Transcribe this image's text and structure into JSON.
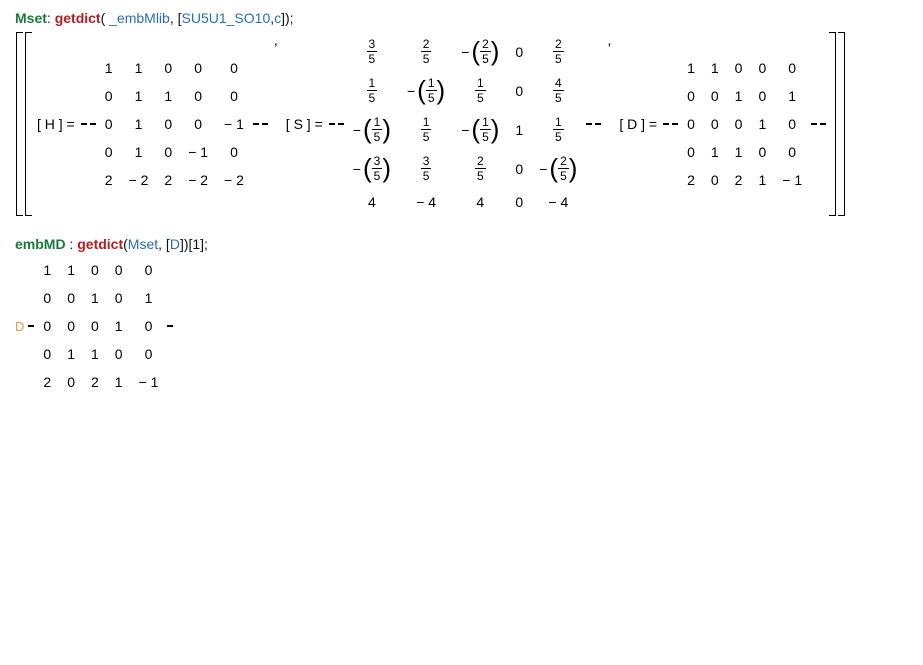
{
  "code1": {
    "var": "Mset",
    "colon": ": ",
    "fn": "getdict",
    "open": "( ",
    "arg1": "_embMlib",
    "sep1": ", [",
    "arg2": "SU5U1_SO10",
    "sep2": ",",
    "arg3": "c",
    "close": "]);"
  },
  "labels": {
    "H": "[ H ] =",
    "S": "[ S ] =",
    "D": "[ D ] =",
    "comma": ","
  },
  "H": [
    [
      "1",
      "1",
      "0",
      "0",
      "0"
    ],
    [
      "0",
      "1",
      "1",
      "0",
      "0"
    ],
    [
      "0",
      "1",
      "0",
      "0",
      "− 1"
    ],
    [
      "0",
      "1",
      "0",
      "− 1",
      "0"
    ],
    [
      "2",
      "− 2",
      "2",
      "− 2",
      "− 2"
    ]
  ],
  "S": [
    [
      {
        "t": "f",
        "n": "3",
        "d": "5"
      },
      {
        "t": "f",
        "n": "2",
        "d": "5"
      },
      {
        "t": "pf",
        "s": "−",
        "n": "2",
        "d": "5"
      },
      {
        "t": "n",
        "v": "0"
      },
      {
        "t": "f",
        "n": "2",
        "d": "5"
      }
    ],
    [
      {
        "t": "f",
        "n": "1",
        "d": "5"
      },
      {
        "t": "pf",
        "s": "−",
        "n": "1",
        "d": "5"
      },
      {
        "t": "f",
        "n": "1",
        "d": "5"
      },
      {
        "t": "n",
        "v": "0"
      },
      {
        "t": "f",
        "n": "4",
        "d": "5"
      }
    ],
    [
      {
        "t": "pf",
        "s": "−",
        "n": "1",
        "d": "5"
      },
      {
        "t": "f",
        "n": "1",
        "d": "5"
      },
      {
        "t": "pf",
        "s": "−",
        "n": "1",
        "d": "5"
      },
      {
        "t": "n",
        "v": "1"
      },
      {
        "t": "f",
        "n": "1",
        "d": "5"
      }
    ],
    [
      {
        "t": "pf",
        "s": "−",
        "n": "3",
        "d": "5"
      },
      {
        "t": "f",
        "n": "3",
        "d": "5"
      },
      {
        "t": "f",
        "n": "2",
        "d": "5"
      },
      {
        "t": "n",
        "v": "0"
      },
      {
        "t": "pf",
        "s": "−",
        "n": "2",
        "d": "5"
      }
    ],
    [
      {
        "t": "n",
        "v": "4"
      },
      {
        "t": "n",
        "v": "− 4"
      },
      {
        "t": "n",
        "v": "4"
      },
      {
        "t": "n",
        "v": "0"
      },
      {
        "t": "n",
        "v": "− 4"
      }
    ]
  ],
  "D": [
    [
      "1",
      "1",
      "0",
      "0",
      "0"
    ],
    [
      "0",
      "0",
      "1",
      "0",
      "1"
    ],
    [
      "0",
      "0",
      "0",
      "1",
      "0"
    ],
    [
      "0",
      "1",
      "1",
      "0",
      "0"
    ],
    [
      "2",
      "0",
      "2",
      "1",
      "− 1"
    ]
  ],
  "code2": {
    "var": "embMD",
    "colon": " : ",
    "fn": "getdict",
    "open": "(",
    "arg1": "Mset",
    "sep1": ", [",
    "arg2": "D",
    "close": "])[1];"
  },
  "outLabel2": "D",
  "M2": [
    [
      "1",
      "1",
      "0",
      "0",
      "0"
    ],
    [
      "0",
      "0",
      "1",
      "0",
      "1"
    ],
    [
      "0",
      "0",
      "0",
      "1",
      "0"
    ],
    [
      "0",
      "1",
      "1",
      "0",
      "0"
    ],
    [
      "2",
      "0",
      "2",
      "1",
      "− 1"
    ]
  ]
}
